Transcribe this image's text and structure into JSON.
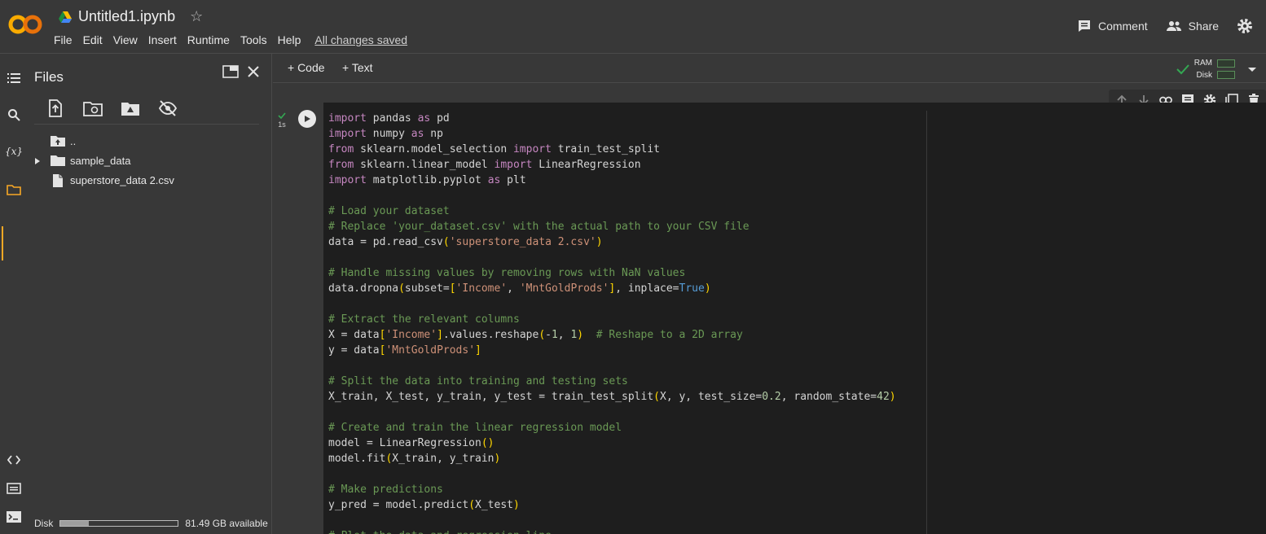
{
  "header": {
    "title": "Untitled1.ipynb",
    "menu": [
      "File",
      "Edit",
      "View",
      "Insert",
      "Runtime",
      "Tools",
      "Help"
    ],
    "saved_status": "All changes saved",
    "comment_label": "Comment",
    "share_label": "Share"
  },
  "files": {
    "title": "Files",
    "tree": [
      {
        "label": ".."
      },
      {
        "label": "sample_data"
      },
      {
        "label": "superstore_data 2.csv"
      }
    ],
    "disk_label": "Disk",
    "disk_available": "81.49 GB available",
    "disk_used_fraction": 0.24
  },
  "toolbar": {
    "code_label": "+ Code",
    "text_label": "+ Text",
    "ram_label": "RAM",
    "disk_label": "Disk"
  },
  "cell": {
    "exec_time": "1s",
    "code_lines": [
      "import pandas as pd",
      "import numpy as np",
      "from sklearn.model_selection import train_test_split",
      "from sklearn.linear_model import LinearRegression",
      "import matplotlib.pyplot as plt",
      "",
      "# Load your dataset",
      "# Replace 'your_dataset.csv' with the actual path to your CSV file",
      "data = pd.read_csv('superstore_data 2.csv')",
      "",
      "# Handle missing values by removing rows with NaN values",
      "data.dropna(subset=['Income', 'MntGoldProds'], inplace=True)",
      "",
      "# Extract the relevant columns",
      "X = data['Income'].values.reshape(-1, 1)  # Reshape to a 2D array",
      "y = data['MntGoldProds']",
      "",
      "# Split the data into training and testing sets",
      "X_train, X_test, y_train, y_test = train_test_split(X, y, test_size=0.2, random_state=42)",
      "",
      "# Create and train the linear regression model",
      "model = LinearRegression()",
      "model.fit(X_train, y_train)",
      "",
      "# Make predictions",
      "y_pred = model.predict(X_test)",
      "",
      "# Plot the data and regression line"
    ]
  }
}
